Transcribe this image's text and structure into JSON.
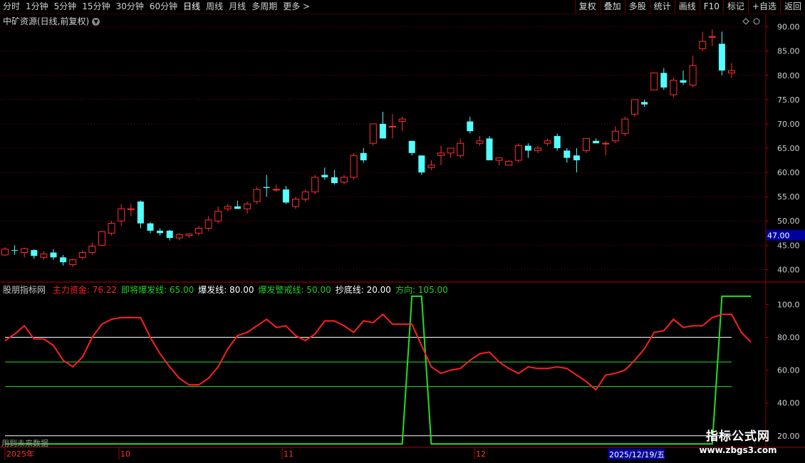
{
  "toolbar": {
    "periods": [
      "分时",
      "1分钟",
      "5分钟",
      "15分钟",
      "30分钟",
      "60分钟",
      "日线",
      "周线",
      "月线",
      "多周期",
      "更多 >"
    ],
    "active_period": "日线",
    "actions": [
      "复权",
      "叠加",
      "多股",
      "统计",
      "画线",
      "F10",
      "标记",
      "+自选",
      "返回"
    ]
  },
  "stock": {
    "title": "中矿资源(日线,前复权)"
  },
  "price_axis": {
    "labels": [
      "90.00",
      "85.00",
      "80.00",
      "75.00",
      "70.00",
      "65.00",
      "60.00",
      "55.00",
      "50.00",
      "45.00",
      "40.00"
    ],
    "highlight": "47.00"
  },
  "indicator": {
    "name": "股朋指标网",
    "items": [
      {
        "text": "主力资金: 76.22",
        "color": "#ff2020"
      },
      {
        "text": "即将爆发线: 65.00",
        "color": "#20d020"
      },
      {
        "text": "爆发线: 80.00",
        "color": "#ffffff"
      },
      {
        "text": "爆发警戒线: 50.00",
        "color": "#20d020"
      },
      {
        "text": "抄底线: 20.00",
        "color": "#ffffff"
      },
      {
        "text": "方向: 105.00",
        "color": "#20d020"
      }
    ],
    "axis_labels": [
      "100.0",
      "80.00",
      "60.00",
      "40.00",
      "20.00"
    ]
  },
  "time_axis": {
    "labels": [
      "2025年",
      "10",
      "11",
      "12"
    ],
    "cursor_date": "2025/12/19/五"
  },
  "future_note": "用到未来数据",
  "watermark": {
    "title": "指标公式网",
    "url": "www.zbgs3.com"
  },
  "colors": {
    "up": "#ff3030",
    "down": "#54ffff",
    "grid": "#8a0000",
    "main_line": "#ff2020",
    "green": "#20e020",
    "white": "#ffffff"
  },
  "chart_data": [
    {
      "type": "candlestick",
      "title": "中矿资源(日线,前复权)",
      "ylim": [
        38,
        92
      ],
      "ohlc": [
        [
          43.0,
          44.6,
          42.8,
          44.2
        ],
        [
          44.0,
          45.0,
          43.0,
          43.9
        ],
        [
          43.5,
          44.5,
          42.5,
          44.3
        ],
        [
          44.0,
          44.2,
          42.2,
          42.8
        ],
        [
          42.5,
          43.8,
          42.0,
          43.2
        ],
        [
          43.5,
          44.2,
          42.0,
          42.5
        ],
        [
          42.5,
          43.0,
          40.8,
          41.5
        ],
        [
          41.0,
          42.3,
          40.5,
          42.0
        ],
        [
          42.5,
          44.0,
          42.0,
          43.5
        ],
        [
          43.5,
          45.5,
          43.0,
          44.8
        ],
        [
          45.0,
          48.0,
          44.8,
          47.8
        ],
        [
          47.5,
          50.0,
          47.0,
          49.5
        ],
        [
          50.0,
          53.5,
          49.0,
          52.5
        ],
        [
          52.5,
          53.5,
          51.0,
          52.5
        ],
        [
          54.0,
          54.2,
          48.5,
          49.5
        ],
        [
          49.5,
          49.8,
          47.5,
          48.0
        ],
        [
          48.0,
          48.5,
          47.0,
          47.5
        ],
        [
          48.0,
          48.2,
          46.0,
          46.5
        ],
        [
          46.5,
          47.5,
          46.0,
          47.2
        ],
        [
          47.0,
          47.5,
          46.5,
          47.3
        ],
        [
          47.5,
          49.0,
          47.0,
          48.5
        ],
        [
          48.5,
          51.0,
          48.0,
          50.2
        ],
        [
          50.0,
          53.0,
          49.5,
          52.0
        ],
        [
          52.5,
          53.5,
          52.0,
          53.0
        ],
        [
          53.0,
          54.2,
          52.5,
          52.5
        ],
        [
          52.5,
          54.0,
          51.5,
          53.5
        ],
        [
          54.0,
          57.0,
          53.5,
          56.5
        ],
        [
          57.0,
          59.5,
          55.0,
          56.8
        ],
        [
          56.5,
          57.5,
          56.0,
          56.5
        ],
        [
          56.5,
          57.2,
          53.5,
          53.8
        ],
        [
          53.0,
          55.0,
          52.5,
          54.5
        ],
        [
          54.5,
          56.5,
          54.0,
          56.0
        ],
        [
          56.0,
          59.5,
          55.5,
          59.0
        ],
        [
          59.5,
          61.0,
          58.5,
          59.0
        ],
        [
          59.0,
          60.5,
          57.5,
          57.8
        ],
        [
          58.0,
          59.5,
          57.5,
          59.0
        ],
        [
          59.0,
          64.0,
          58.5,
          63.5
        ],
        [
          64.0,
          65.0,
          62.0,
          62.5
        ],
        [
          66.0,
          70.0,
          65.5,
          70.0
        ],
        [
          70.0,
          72.5,
          67.5,
          67.0
        ],
        [
          69.5,
          72.0,
          67.0,
          69.5
        ],
        [
          70.5,
          71.5,
          68.5,
          71.0
        ],
        [
          66.5,
          66.5,
          63.5,
          64.0
        ],
        [
          63.5,
          63.5,
          59.5,
          60.0
        ],
        [
          61.0,
          62.5,
          60.5,
          61.5
        ],
        [
          63.5,
          65.5,
          61.5,
          64.0
        ],
        [
          64.0,
          65.0,
          63.0,
          65.0
        ],
        [
          63.5,
          67.0,
          63.0,
          66.0
        ],
        [
          70.5,
          71.5,
          68.0,
          68.5
        ],
        [
          66.0,
          67.5,
          65.5,
          66.5
        ],
        [
          67.0,
          67.5,
          62.5,
          62.5
        ],
        [
          62.5,
          63.0,
          61.5,
          63.0
        ],
        [
          61.5,
          62.5,
          61.5,
          62.3
        ],
        [
          62.5,
          66.0,
          62.0,
          65.5
        ],
        [
          65.5,
          66.0,
          63.0,
          64.5
        ],
        [
          64.5,
          65.5,
          64.0,
          65.0
        ],
        [
          66.0,
          67.0,
          65.5,
          66.5
        ],
        [
          67.5,
          68.0,
          64.5,
          65.0
        ],
        [
          64.5,
          65.0,
          62.0,
          63.0
        ],
        [
          63.5,
          65.0,
          60.0,
          62.5
        ],
        [
          64.5,
          67.0,
          64.0,
          67.0
        ],
        [
          66.5,
          67.0,
          66.0,
          66.0
        ],
        [
          66.0,
          66.5,
          63.5,
          66.0
        ],
        [
          66.5,
          69.5,
          66.0,
          68.5
        ],
        [
          68.0,
          71.5,
          67.5,
          71.0
        ],
        [
          72.0,
          75.0,
          71.5,
          75.0
        ],
        [
          74.5,
          75.0,
          73.5,
          74.0
        ],
        [
          77.0,
          80.5,
          77.0,
          80.5
        ],
        [
          80.5,
          81.5,
          77.0,
          77.5
        ],
        [
          76.0,
          79.5,
          75.5,
          79.0
        ],
        [
          79.0,
          81.0,
          78.0,
          78.5
        ],
        [
          78.0,
          84.0,
          77.5,
          82.0
        ],
        [
          85.5,
          89.0,
          85.0,
          87.0
        ],
        [
          88.0,
          89.5,
          86.0,
          88.0
        ],
        [
          86.5,
          89.0,
          80.0,
          81.0
        ],
        [
          80.5,
          82.5,
          79.5,
          81.0
        ]
      ]
    },
    {
      "type": "line",
      "ylim": [
        16,
        108
      ],
      "series": [
        {
          "name": "主力资金",
          "values": [
            78,
            82,
            87,
            79,
            79,
            75,
            66,
            62,
            68,
            80,
            88,
            91,
            92,
            92,
            92,
            80,
            70,
            62,
            55,
            51,
            51,
            55,
            62,
            73,
            81,
            83,
            87,
            91,
            86,
            87,
            81,
            78,
            82,
            90,
            90,
            87,
            83,
            90,
            89,
            94,
            88,
            88,
            88,
            75,
            62,
            58,
            60,
            61,
            66,
            70,
            71,
            65,
            61,
            58,
            62,
            61,
            61,
            62,
            61,
            57,
            53,
            48,
            57,
            58,
            60,
            66,
            73,
            83,
            84,
            91,
            86,
            87,
            87,
            92,
            94,
            94,
            83,
            77
          ]
        },
        {
          "name": "即将爆发线",
          "values": [
            65
          ]
        },
        {
          "name": "爆发线",
          "values": [
            80
          ]
        },
        {
          "name": "爆发警戒线",
          "values": [
            50
          ]
        },
        {
          "name": "抄底线",
          "values": [
            20
          ]
        },
        {
          "name": "方向",
          "values": [
            15,
            15,
            15,
            15,
            15,
            15,
            15,
            15,
            15,
            15,
            15,
            15,
            15,
            15,
            15,
            15,
            15,
            15,
            15,
            15,
            15,
            15,
            15,
            15,
            15,
            15,
            15,
            15,
            15,
            15,
            15,
            15,
            15,
            15,
            15,
            15,
            15,
            15,
            15,
            15,
            15,
            15,
            105,
            105,
            15,
            15,
            15,
            15,
            15,
            15,
            15,
            15,
            15,
            15,
            15,
            15,
            15,
            15,
            15,
            15,
            15,
            15,
            15,
            15,
            15,
            15,
            15,
            15,
            15,
            15,
            15,
            15,
            15,
            15,
            105,
            105,
            105,
            105
          ]
        }
      ]
    }
  ]
}
